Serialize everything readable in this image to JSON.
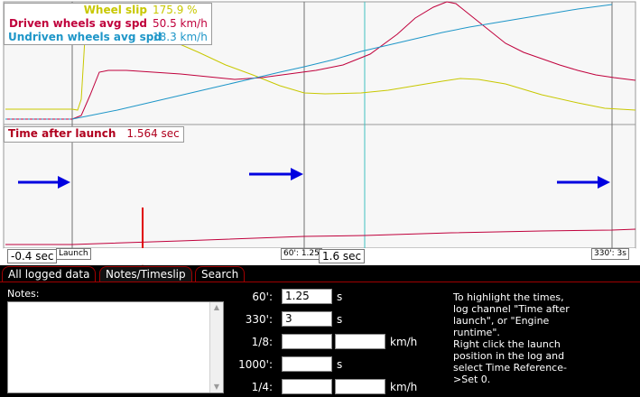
{
  "legend": {
    "rows": [
      {
        "name": "Wheel slip",
        "value": "175.9 %",
        "color": "#c8c800"
      },
      {
        "name": "Driven wheels avg spd",
        "value": "50.5 km/h",
        "color": "#c0003c"
      },
      {
        "name": "Undriven wheels avg spd",
        "value": "18.3 km/h",
        "color": "#1e96c8"
      }
    ]
  },
  "time_after_launch": {
    "label": "Time after launch",
    "value": "1.564 sec"
  },
  "markers": {
    "left_offset": "-0.4 sec",
    "launch": "Launch",
    "sixty": "60': 1.25",
    "cursor_time": "1.6 sec",
    "three_thirty": "330': 3s"
  },
  "tabs": [
    {
      "label": "All logged data",
      "active": false
    },
    {
      "label": "Notes/Timeslip",
      "active": true
    },
    {
      "label": "Search",
      "active": false
    }
  ],
  "notes": {
    "label": "Notes:",
    "value": ""
  },
  "timeslip": [
    {
      "label": "60':",
      "value": "1.25",
      "unit": "s"
    },
    {
      "label": "330':",
      "value": "3",
      "unit": "s"
    },
    {
      "label": "1/8:",
      "value": "",
      "value2": "",
      "unit": "km/h"
    },
    {
      "label": "1000':",
      "value": "",
      "unit": "s"
    },
    {
      "label": "1/4:",
      "value": "",
      "value2": "",
      "unit": "km/h"
    }
  ],
  "help_text": "To highlight the times, log channel \"Time after launch\", or \"Engine runtime\".\nRight click the launch position in the log and select Time Reference->Set 0.",
  "colors": {
    "accent": "#a00000",
    "arrow_red": "#e00000",
    "arrow_blue": "#0000e0",
    "cursor_line": "#40c0c0"
  }
}
